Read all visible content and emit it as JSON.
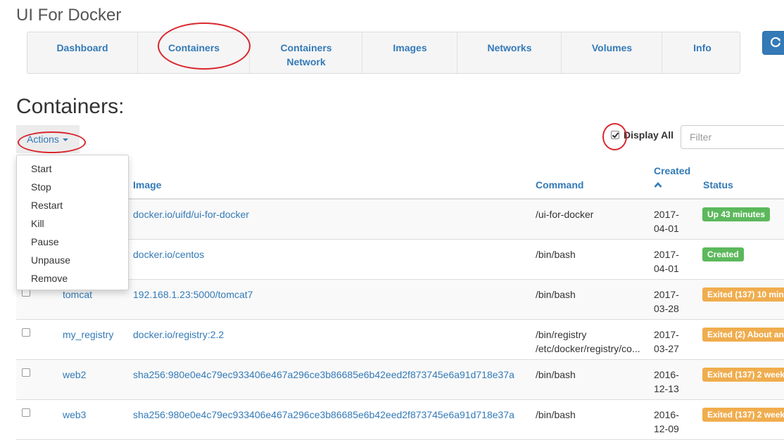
{
  "app": {
    "title": "UI For Docker"
  },
  "nav": {
    "items": [
      {
        "label": "Dashboard"
      },
      {
        "label": "Containers"
      },
      {
        "label": "Containers Network"
      },
      {
        "label": "Images"
      },
      {
        "label": "Networks"
      },
      {
        "label": "Volumes"
      },
      {
        "label": "Info"
      }
    ]
  },
  "page": {
    "title": "Containers:"
  },
  "actions": {
    "label": "Actions",
    "menu": [
      "Start",
      "Stop",
      "Restart",
      "Kill",
      "Pause",
      "Unpause",
      "Remove"
    ]
  },
  "toolbar": {
    "display_all_label": "Display All",
    "display_all_checked": true,
    "filter_placeholder": "Filter"
  },
  "table": {
    "headers": {
      "image": "Image",
      "command": "Command",
      "created": "Created",
      "status": "Status"
    },
    "rows": [
      {
        "name": "",
        "image": "docker.io/uifd/ui-for-docker",
        "command": [
          "/ui-for-docker"
        ],
        "created": [
          "2017-",
          "04-01"
        ],
        "status": "Up 43 minutes",
        "status_kind": "success"
      },
      {
        "name": "",
        "image": "docker.io/centos",
        "command": [
          "/bin/bash"
        ],
        "created": [
          "2017-",
          "04-01"
        ],
        "status": "Created",
        "status_kind": "success"
      },
      {
        "name": "tomcat",
        "image": "192.168.1.23:5000/tomcat7",
        "command": [
          "/bin/bash"
        ],
        "created": [
          "2017-",
          "03-28"
        ],
        "status": "Exited (137) 10 min",
        "status_kind": "warning"
      },
      {
        "name": "my_registry",
        "image": "docker.io/registry:2.2",
        "command": [
          "/bin/registry",
          "/etc/docker/registry/co..."
        ],
        "created": [
          "2017-",
          "03-27"
        ],
        "status": "Exited (2) About an",
        "status_kind": "warning"
      },
      {
        "name": "web2",
        "image": "sha256:980e0e4c79ec933406e467a296ce3b86685e6b42eed2f873745e6a91d718e37a",
        "command": [
          "/bin/bash"
        ],
        "created": [
          "2016-",
          "12-13"
        ],
        "status": "Exited (137) 2 week",
        "status_kind": "warning"
      },
      {
        "name": "web3",
        "image": "sha256:980e0e4c79ec933406e467a296ce3b86685e6b42eed2f873745e6a91d718e37a",
        "command": [
          "/bin/bash"
        ],
        "created": [
          "2016-",
          "12-09"
        ],
        "status": "Exited (137) 2 week",
        "status_kind": "warning"
      }
    ]
  },
  "colors": {
    "link": "#337ab7",
    "success": "#5cb85c",
    "warning": "#f0ad4e",
    "annotation": "#d9272e"
  },
  "icons": {
    "refresh": "refresh-icon",
    "sort": "sort-asc-icon",
    "caret": "caret-down-icon"
  }
}
